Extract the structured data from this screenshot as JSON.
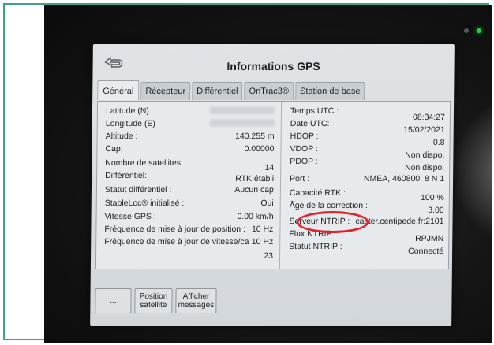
{
  "header": {
    "title": "Informations GPS"
  },
  "tabs": [
    {
      "label": "Général"
    },
    {
      "label": "Récepteur"
    },
    {
      "label": "Différentiel"
    },
    {
      "label": "OnTrac3®"
    },
    {
      "label": "Station de base"
    }
  ],
  "left_fields": {
    "latitude": {
      "label": "Latitude (N)",
      "value": ""
    },
    "longitude": {
      "label": "Longitude (E)",
      "value": ""
    },
    "altitude": {
      "label": "Altitude :",
      "value": "140.255 m"
    },
    "cap": {
      "label": "Cap:",
      "value": "0.00000"
    },
    "satellites": {
      "label": "Nombre de satellites:",
      "value": "14"
    },
    "differentiel": {
      "label": "Différentiel:",
      "value": "RTK établi"
    },
    "statut_diff": {
      "label": "Statut différentiel :",
      "value": "Aucun cap"
    },
    "stableloc": {
      "label": "StableLoc® initialisé :",
      "value": "Oui"
    },
    "vitesse": {
      "label": "Vitesse GPS :",
      "value": "0.00 km/h"
    },
    "freq_pos": {
      "label": "Fréquence de mise à jour de position :",
      "value": "10 Hz"
    },
    "freq_vit": {
      "label": "Fréquence de mise à jour de vitesse/ca",
      "value": "10 Hz"
    },
    "extra": {
      "value": "23"
    }
  },
  "right_fields": {
    "temps": {
      "label": "Temps UTC :",
      "value": "08:34:27"
    },
    "date": {
      "label": "Date UTC:",
      "value": "15/02/2021"
    },
    "hdop": {
      "label": "HDOP :",
      "value": "0.8"
    },
    "vdop": {
      "label": "VDOP :",
      "value": "Non dispo."
    },
    "pdop": {
      "label": "PDOP :",
      "value": "Non dispo."
    },
    "port": {
      "label": "Port :",
      "value": "NMEA, 460800, 8 N 1"
    },
    "capacite": {
      "label": "Capacité RTK :",
      "value": "100 %"
    },
    "age": {
      "label": "Âge de la correction :",
      "value": "3.00"
    },
    "serveur": {
      "label": "Serveur NTRIP :",
      "value": "caster.centipede.fr:2101"
    },
    "flux": {
      "label": "Flux NTRIP :",
      "value": "RPJMN"
    },
    "statut_ntrip": {
      "label": "Statut NTRIP :",
      "value": "Connecté"
    }
  },
  "bottom_buttons": {
    "more": "...",
    "position_satellite": "Position satellite",
    "afficher_messages": "Afficher messages"
  },
  "colors": {
    "highlight_ellipse": "#e3232b",
    "frame": "#3aa38a",
    "led": "#27d04b"
  }
}
